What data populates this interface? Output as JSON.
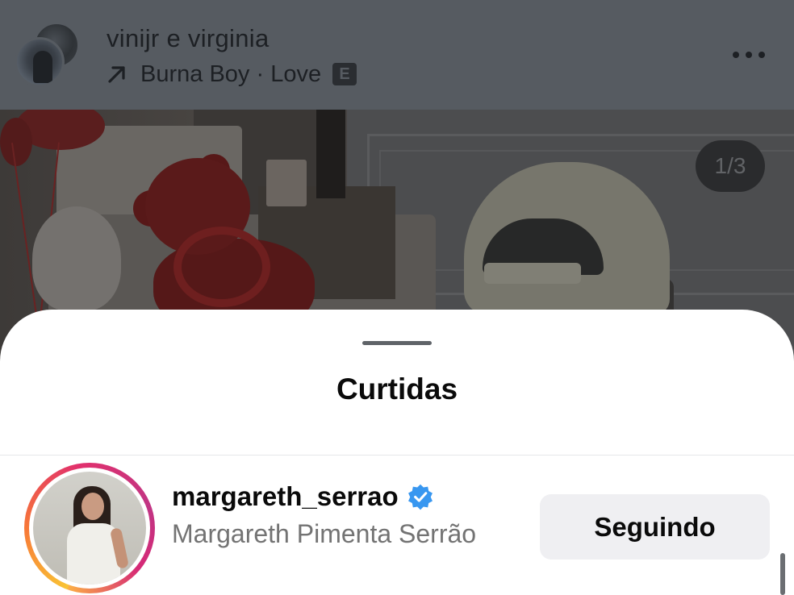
{
  "post": {
    "usernames": "vinijr e virginia",
    "music": {
      "artist": "Burna Boy",
      "separator": " · ",
      "track": "Love",
      "explicit_badge": "E"
    },
    "more_icon": "more-horizontal-icon",
    "page_counter": "1/3"
  },
  "sheet": {
    "title": "Curtidas",
    "likes": [
      {
        "username": "margareth_serrao",
        "verified": true,
        "full_name": "Margareth Pimenta Serrão",
        "button_label": "Seguindo",
        "has_story_ring": true
      }
    ]
  },
  "colors": {
    "overlay_dim": "#565b61",
    "verified_blue": "#3897f0",
    "button_bg": "#efeff2",
    "secondary_text": "#737373"
  }
}
